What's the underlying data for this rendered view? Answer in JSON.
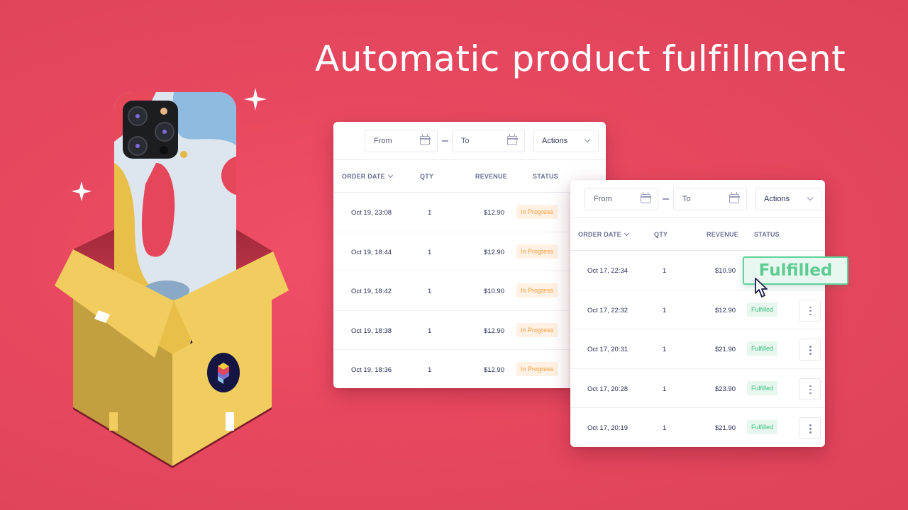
{
  "headline": "Automatic product fulfillment",
  "colors": {
    "background": "#e8485f",
    "in_progress_text": "#f59b3c",
    "in_progress_bg": "#fff1e3",
    "fulfilled_text": "#3ec283",
    "fulfilled_bg": "#e7f7ef",
    "text_primary": "#2b2d5a",
    "text_header": "#6c6f94"
  },
  "illustration": {
    "description": "Phone with colorful case emerging from an open yellow shipping box",
    "icons": [
      "sparkle-icon",
      "sparkle-icon",
      "brand-logo-icon"
    ]
  },
  "back_table": {
    "toolbar": {
      "from_placeholder": "From",
      "to_placeholder": "To",
      "actions_label": "Actions"
    },
    "columns": [
      "ORDER DATE",
      "QTY",
      "REVENUE",
      "STATUS"
    ],
    "rows": [
      {
        "date": "Oct 19, 23:08",
        "qty": "1",
        "revenue": "$12.90",
        "status": "In Progress"
      },
      {
        "date": "Oct 19, 18:44",
        "qty": "1",
        "revenue": "$12.90",
        "status": "In Progress"
      },
      {
        "date": "Oct 19, 18:42",
        "qty": "1",
        "revenue": "$10.90",
        "status": "In Progress"
      },
      {
        "date": "Oct 19, 18:38",
        "qty": "1",
        "revenue": "$12.90",
        "status": "In Progress"
      },
      {
        "date": "Oct 19, 18:36",
        "qty": "1",
        "revenue": "$12.90",
        "status": "In Progress"
      }
    ]
  },
  "front_table": {
    "toolbar": {
      "from_placeholder": "From",
      "to_placeholder": "To",
      "actions_label": "Actions"
    },
    "columns": [
      "ORDER DATE",
      "QTY",
      "REVENUE",
      "STATUS"
    ],
    "rows": [
      {
        "date": "Oct 17, 22:34",
        "qty": "1",
        "revenue": "$10.90",
        "status": ""
      },
      {
        "date": "Oct 17, 22:32",
        "qty": "1",
        "revenue": "$12.90",
        "status": "Fulfilled"
      },
      {
        "date": "Oct 17, 20:31",
        "qty": "1",
        "revenue": "$21.90",
        "status": "Fulfilled"
      },
      {
        "date": "Oct 17, 20:28",
        "qty": "1",
        "revenue": "$23.90",
        "status": "Fulfilled"
      },
      {
        "date": "Oct 17, 20:19",
        "qty": "1",
        "revenue": "$21.90",
        "status": "Fulfilled"
      }
    ]
  },
  "callout": {
    "label": "Fulfilled"
  }
}
